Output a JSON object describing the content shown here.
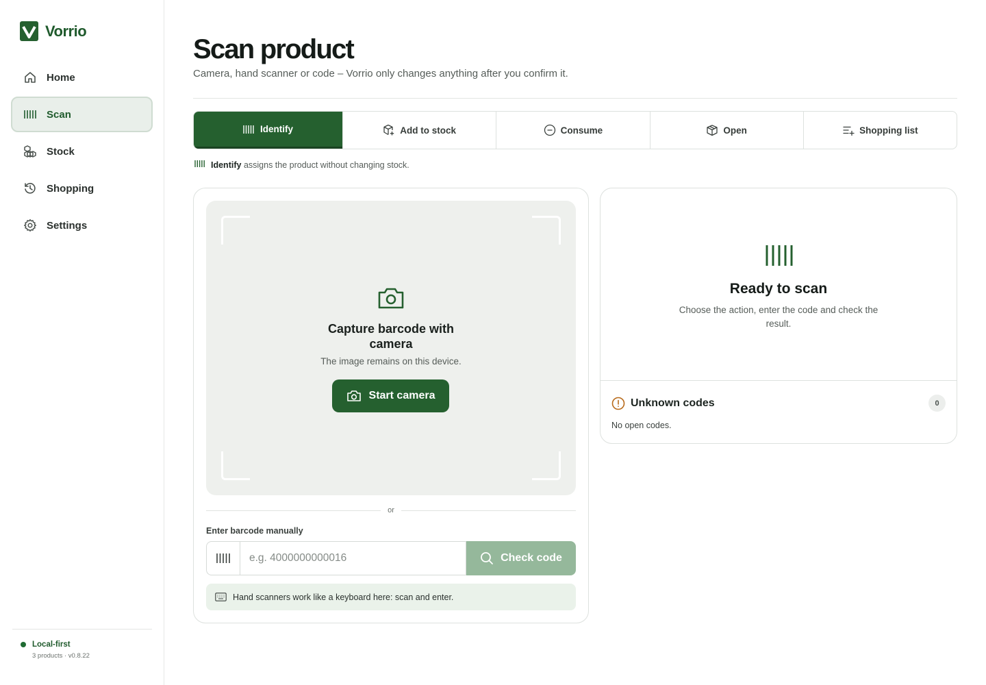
{
  "app": {
    "name": "Vorrio"
  },
  "sidebar": {
    "items": [
      {
        "label": "Home",
        "icon": "home-icon"
      },
      {
        "label": "Scan",
        "icon": "barcode-icon",
        "active": true
      },
      {
        "label": "Stock",
        "icon": "boxes-icon"
      },
      {
        "label": "Shopping",
        "icon": "history-icon"
      },
      {
        "label": "Settings",
        "icon": "gear-icon"
      }
    ],
    "footer": {
      "status": "Local-first",
      "meta": "3 products · v0.8.22"
    }
  },
  "header": {
    "title": "Scan product",
    "subtitle": "Camera, hand scanner or code – Vorrio only changes anything after you confirm it."
  },
  "tabs": [
    {
      "label": "Identify",
      "icon": "barcode-icon",
      "active": true
    },
    {
      "label": "Add to stock",
      "icon": "box-plus-icon"
    },
    {
      "label": "Consume",
      "icon": "minus-circle-icon"
    },
    {
      "label": "Open",
      "icon": "open-box-icon"
    },
    {
      "label": "Shopping list",
      "icon": "list-plus-icon"
    }
  ],
  "mode_hint": {
    "mode": "Identify",
    "text": "assigns the product without changing stock."
  },
  "camera": {
    "title": "Capture barcode with camera",
    "subtitle": "The image remains on this device.",
    "button": "Start camera"
  },
  "manual": {
    "divider": "or",
    "label": "Enter barcode manually",
    "placeholder": "e.g. 4000000000016",
    "button": "Check code",
    "hint": "Hand scanners work like a keyboard here: scan and enter."
  },
  "result": {
    "title": "Ready to scan",
    "subtitle": "Choose the action, enter the code and check the result."
  },
  "unknown_codes": {
    "title": "Unknown codes",
    "count": "0",
    "empty": "No open codes."
  },
  "colors": {
    "brand": "#25602f",
    "brand_light": "#95b89b",
    "hint_bg": "#eaf2ea",
    "warning": "#b86a1a"
  }
}
